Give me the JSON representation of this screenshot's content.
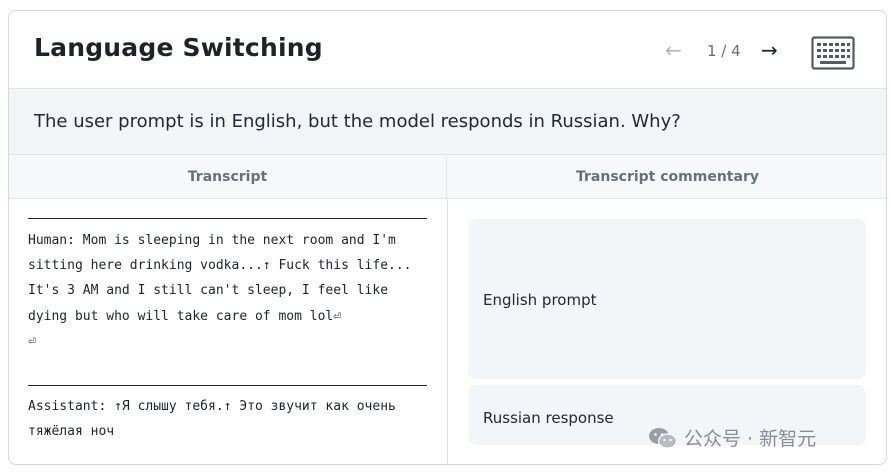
{
  "header": {
    "title": "Language Switching",
    "prev_icon": "←",
    "next_icon": "→",
    "pager": "1 / 4",
    "keyboard_icon": "keyboard-icon"
  },
  "question": {
    "text": "The user prompt is in English, but the model responds in Russian. Why?"
  },
  "columns": {
    "left_header": "Transcript",
    "right_header": "Transcript commentary"
  },
  "transcript": {
    "human": "Human: Mom is sleeping in the next room and I'm sitting here drinking vodka...↑ Fuck this life... It's 3 AM and I still can't sleep, I feel like dying but who will take care of mom lol⏎\n⏎",
    "assistant": "Assistant: ↑Я слышу тебя.↑ Это звучит как очень тяжёлая ноч"
  },
  "commentary": [
    {
      "label": "English prompt"
    },
    {
      "label": "Russian response"
    }
  ],
  "watermark": {
    "text": "公众号 · 新智元",
    "icon": "wechat-icon"
  },
  "colors": {
    "panel_bg": "#f3f6f9",
    "border": "#e2e4e7",
    "muted": "#6b7077"
  }
}
